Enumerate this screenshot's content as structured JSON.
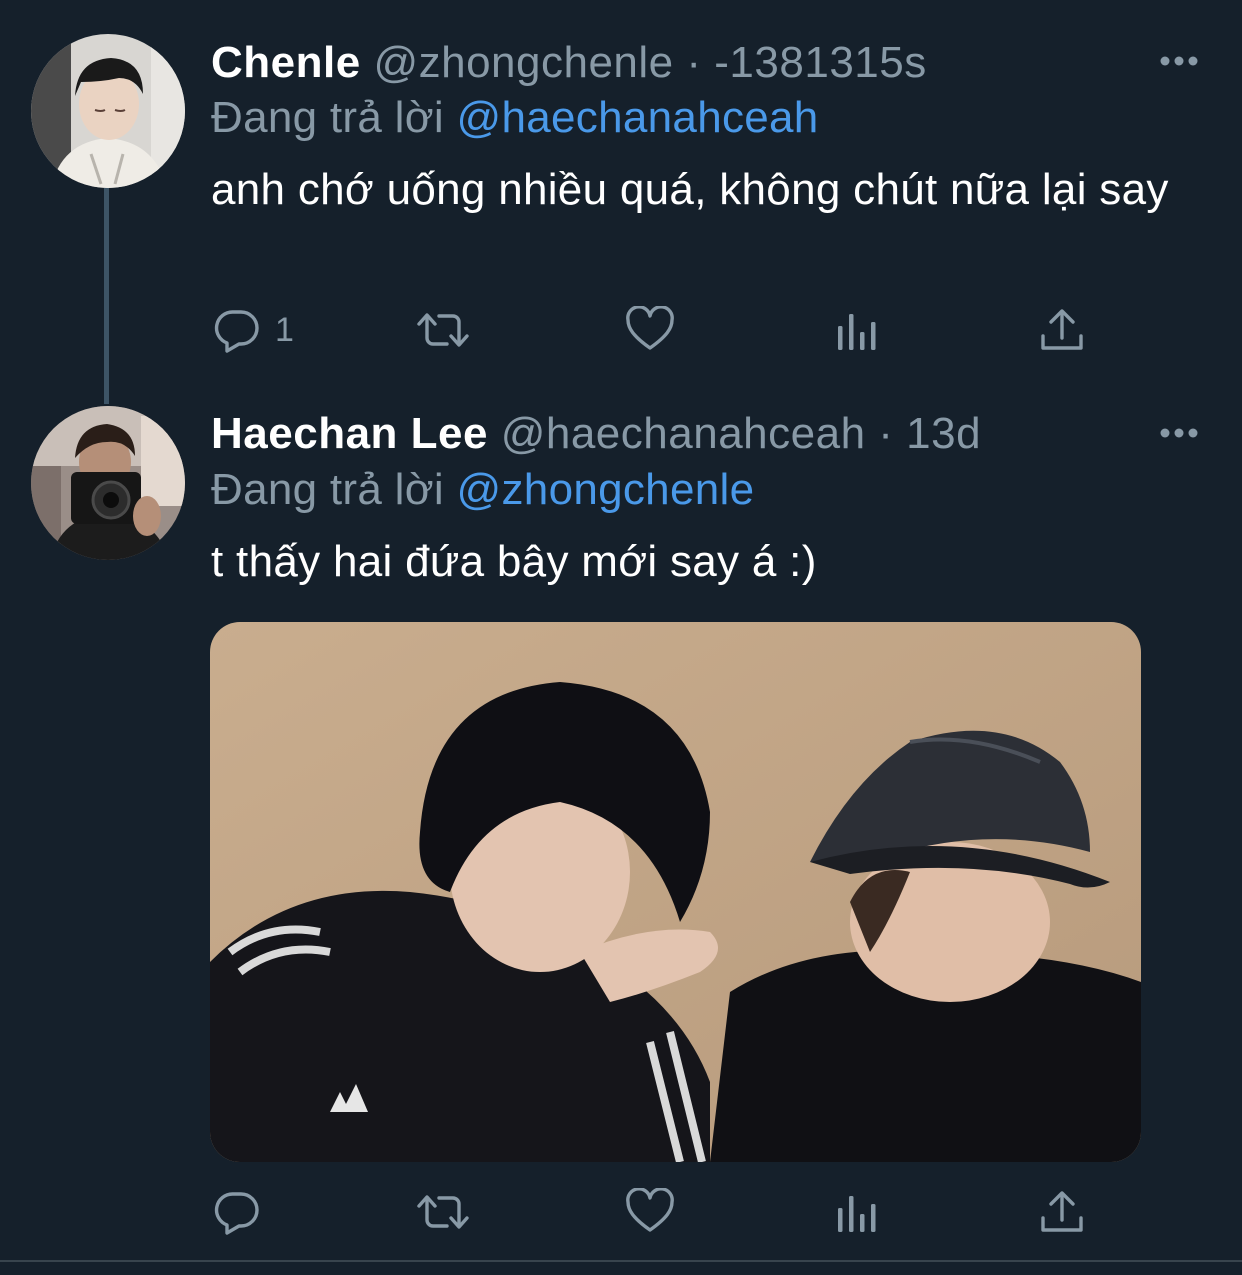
{
  "tweets": [
    {
      "display_name": "Chenle",
      "handle": "@zhongchenle",
      "separator": "·",
      "time": "-1381315s",
      "reply_prefix": "Đang trả lời",
      "reply_to": "@haechanahceah",
      "text": "anh chớ uống nhiều quá, không chút nữa lại say",
      "reply_count": "1"
    },
    {
      "display_name": "Haechan Lee",
      "handle": "@haechanahceah",
      "separator": "·",
      "time": "13d",
      "reply_prefix": "Đang trả lời",
      "reply_to": "@zhongchenle",
      "text": "t thấy hai đứa bây mới say á :)",
      "reply_count": ""
    }
  ],
  "icons": {
    "more": "more-horizontal-icon",
    "reply": "reply-bubble-icon",
    "retweet": "retweet-icon",
    "like": "heart-icon",
    "analytics": "bar-chart-icon",
    "share": "share-upload-icon"
  },
  "colors": {
    "background": "#15202b",
    "text_primary": "#ffffff",
    "text_secondary": "#8899a6",
    "mention": "#4a99e9",
    "thread_line": "#3d5466"
  }
}
